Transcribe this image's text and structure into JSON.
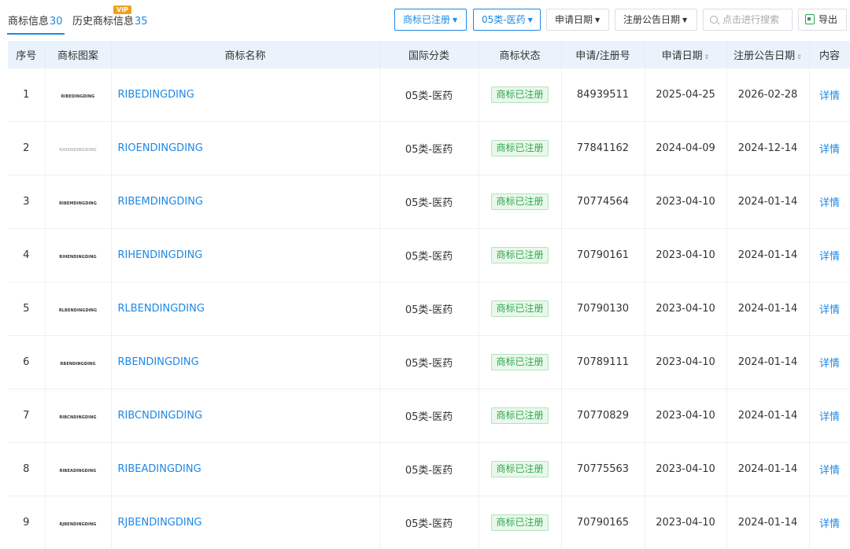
{
  "tabs": {
    "trademark": {
      "label": "商标信息",
      "count": "30"
    },
    "history": {
      "label": "历史商标信息",
      "count": "35",
      "badge": "VIP"
    }
  },
  "filters": {
    "status": "商标已注册",
    "class": "05类-医药",
    "apply_date": "申请日期",
    "announce_date": "注册公告日期"
  },
  "search": {
    "placeholder": "点击进行搜索"
  },
  "export_label": "导出",
  "columns": [
    "序号",
    "商标图案",
    "商标名称",
    "国际分类",
    "商标状态",
    "申请/注册号",
    "申请日期",
    "注册公告日期",
    "内容"
  ],
  "rows": [
    {
      "no": "1",
      "logo": "RIBEDINGDING",
      "name": "RIBEDINGDING",
      "class": "05类-医药",
      "status": "商标已注册",
      "reg_no": "84939511",
      "apply_date": "2025-04-25",
      "announce_date": "2026-02-28",
      "detail": "详情"
    },
    {
      "no": "2",
      "logo": "RIOENDINGDING",
      "name": "RIOENDINGDING",
      "class": "05类-医药",
      "status": "商标已注册",
      "reg_no": "77841162",
      "apply_date": "2024-04-09",
      "announce_date": "2024-12-14",
      "detail": "详情"
    },
    {
      "no": "3",
      "logo": "RIBEMDINGDING",
      "name": "RIBEMDINGDING",
      "class": "05类-医药",
      "status": "商标已注册",
      "reg_no": "70774564",
      "apply_date": "2023-04-10",
      "announce_date": "2024-01-14",
      "detail": "详情"
    },
    {
      "no": "4",
      "logo": "RIHENDINGDING",
      "name": "RIHENDINGDING",
      "class": "05类-医药",
      "status": "商标已注册",
      "reg_no": "70790161",
      "apply_date": "2023-04-10",
      "announce_date": "2024-01-14",
      "detail": "详情"
    },
    {
      "no": "5",
      "logo": "RLBENDINGDING",
      "name": "RLBENDINGDING",
      "class": "05类-医药",
      "status": "商标已注册",
      "reg_no": "70790130",
      "apply_date": "2023-04-10",
      "announce_date": "2024-01-14",
      "detail": "详情"
    },
    {
      "no": "6",
      "logo": "RBENDINGDING",
      "name": "RBENDINGDING",
      "class": "05类-医药",
      "status": "商标已注册",
      "reg_no": "70789111",
      "apply_date": "2023-04-10",
      "announce_date": "2024-01-14",
      "detail": "详情"
    },
    {
      "no": "7",
      "logo": "RIBCNDINGDING",
      "name": "RIBCNDINGDING",
      "class": "05类-医药",
      "status": "商标已注册",
      "reg_no": "70770829",
      "apply_date": "2023-04-10",
      "announce_date": "2024-01-14",
      "detail": "详情"
    },
    {
      "no": "8",
      "logo": "RIBEADINGDING",
      "name": "RIBEADINGDING",
      "class": "05类-医药",
      "status": "商标已注册",
      "reg_no": "70775563",
      "apply_date": "2023-04-10",
      "announce_date": "2024-01-14",
      "detail": "详情"
    },
    {
      "no": "9",
      "logo": "RJBENDINGDING",
      "name": "RJBENDINGDING",
      "class": "05类-医药",
      "status": "商标已注册",
      "reg_no": "70790165",
      "apply_date": "2023-04-10",
      "announce_date": "2024-01-14",
      "detail": "详情"
    }
  ],
  "colors": {
    "accent": "#1e88e5",
    "status_green": "#2fa84f",
    "header_bg": "#eaf3fb"
  }
}
